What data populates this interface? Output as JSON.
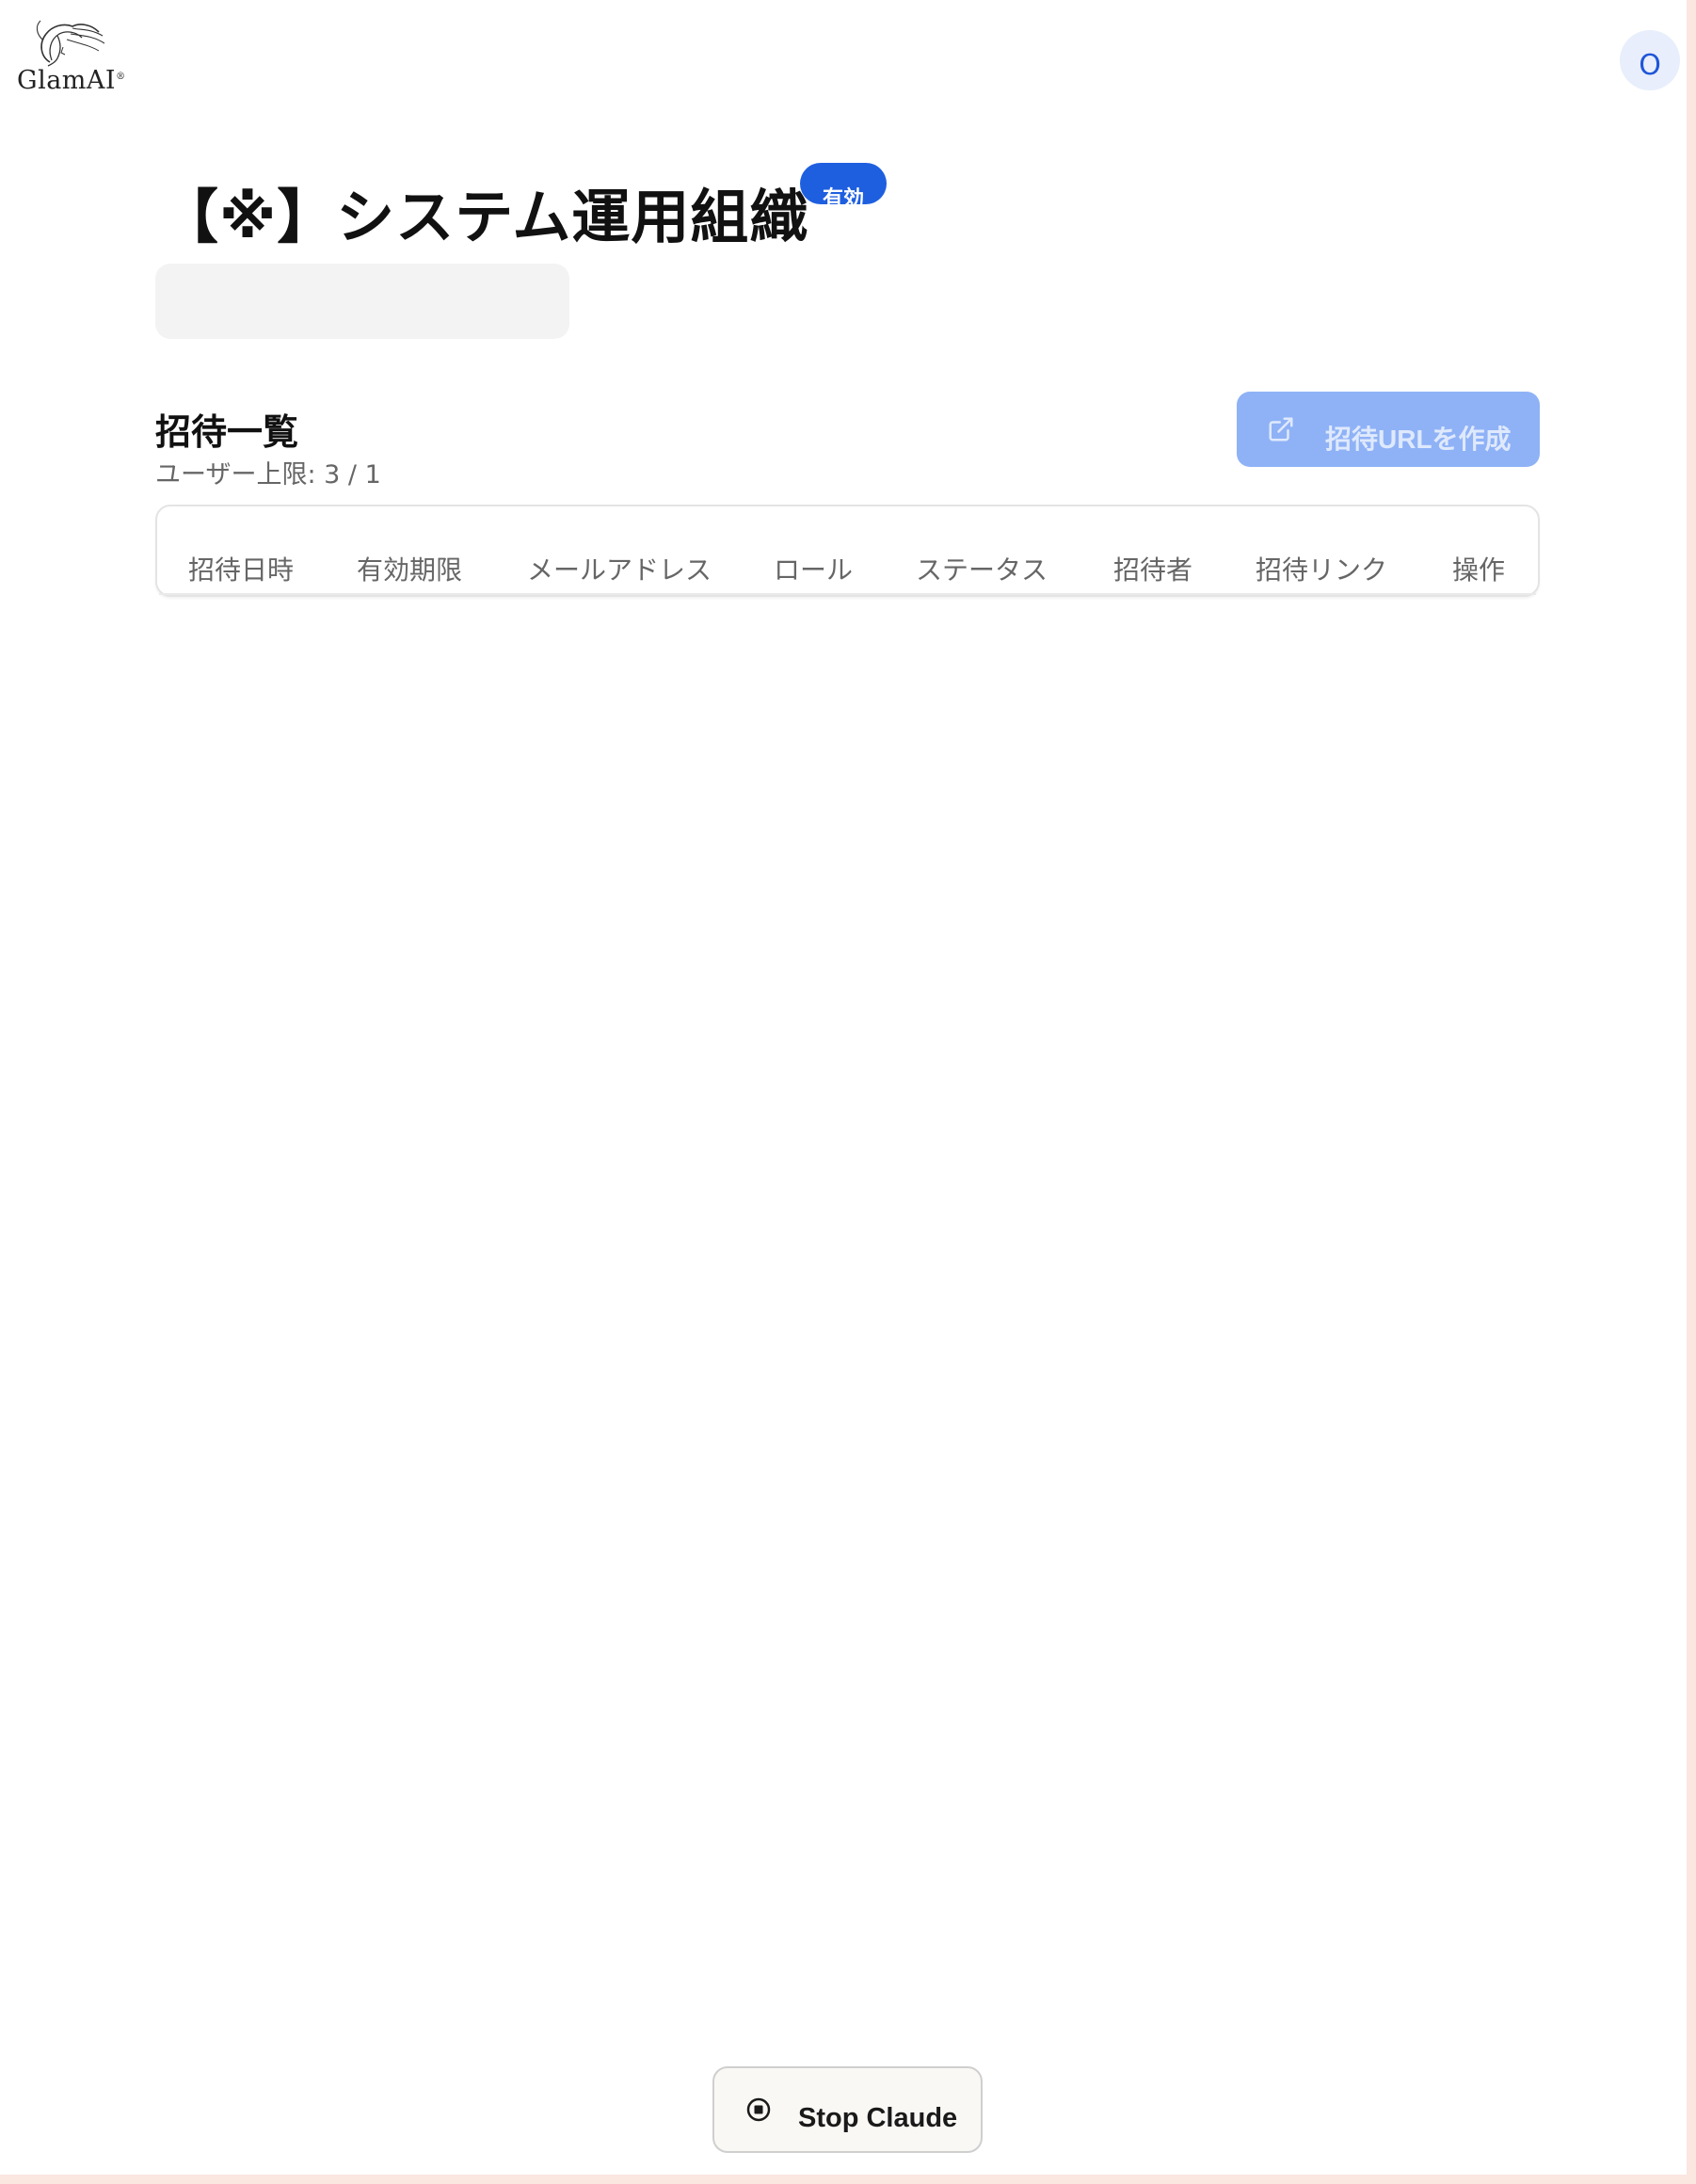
{
  "app": {
    "logo_text": "GlamAI",
    "avatar_initial": "O"
  },
  "org": {
    "name": "【※】システム運用組織",
    "status_badge": "有効"
  },
  "invites": {
    "title": "招待一覧",
    "user_limit": "ユーザー上限: 3 / 1",
    "create_button": "招待URLを作成",
    "columns": [
      "招待日時",
      "有効期限",
      "メールアドレス",
      "ロール",
      "ステータス",
      "招待者",
      "招待リンク",
      "操作"
    ]
  },
  "agent": {
    "stop_label": "Stop Claude"
  },
  "colors": {
    "accent": "#1e5fe0",
    "button_disabled": "#8fb2f6",
    "avatar_bg": "#e8eefb"
  }
}
